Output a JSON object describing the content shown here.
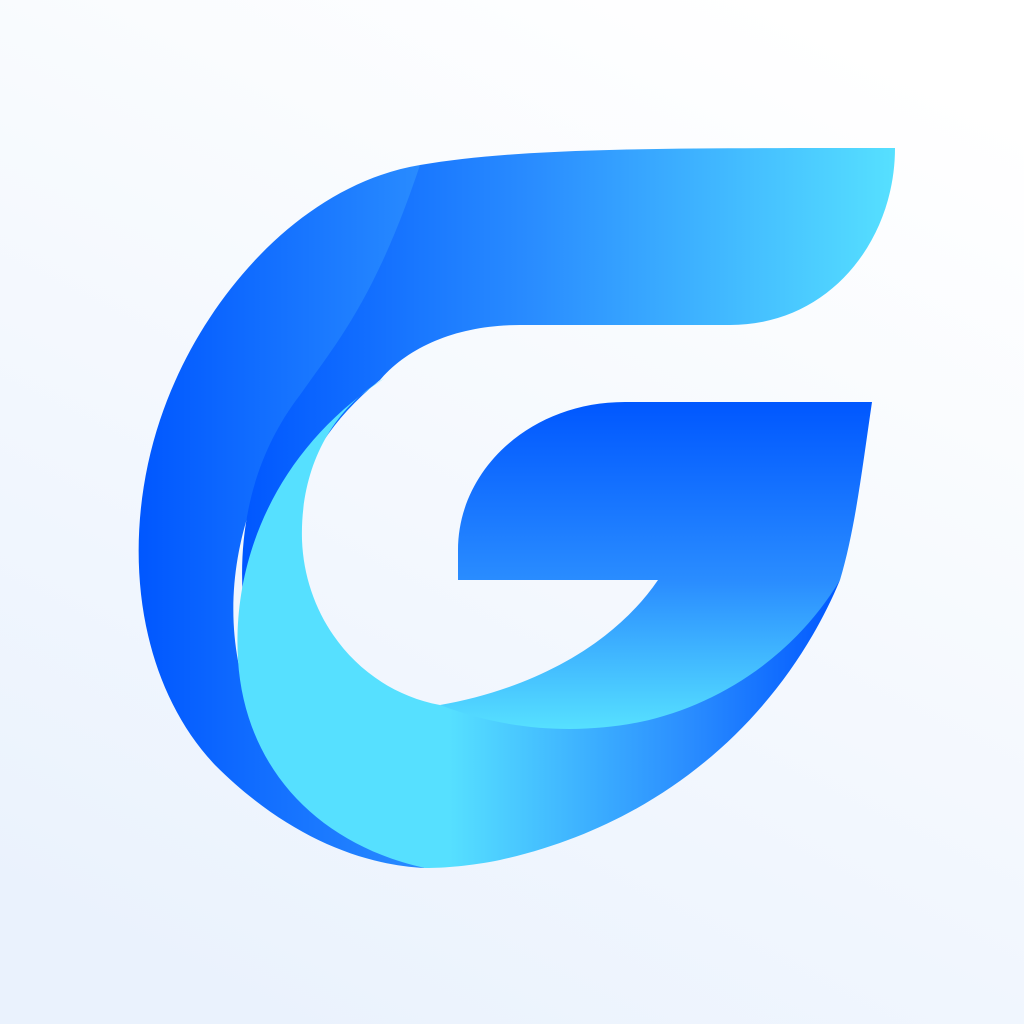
{
  "app_icon": {
    "icon": "g-logo-icon",
    "colors": {
      "background_top": "#ffffff",
      "background_bottom": "#eaf2fd",
      "blue_deep": "#0057ff",
      "blue_mid": "#2a8dff",
      "cyan_light": "#56e0ff"
    }
  }
}
